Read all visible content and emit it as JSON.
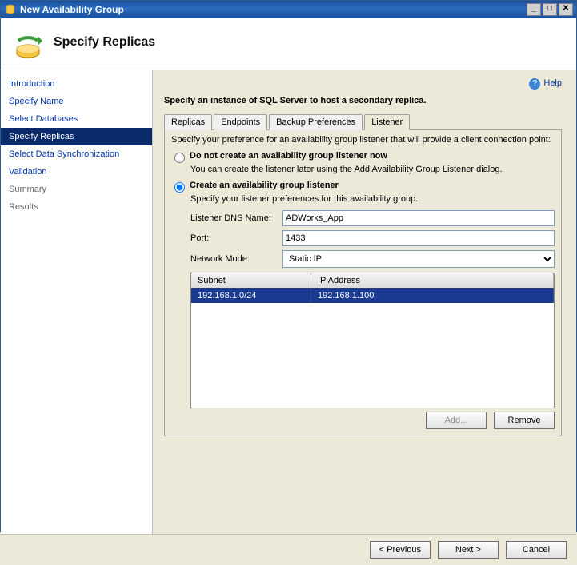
{
  "window": {
    "title": "New Availability Group"
  },
  "header": {
    "title": "Specify Replicas"
  },
  "help": {
    "label": "Help"
  },
  "sidebar": {
    "items": [
      {
        "label": "Introduction",
        "state": "link"
      },
      {
        "label": "Specify Name",
        "state": "link"
      },
      {
        "label": "Select Databases",
        "state": "link"
      },
      {
        "label": "Specify Replicas",
        "state": "active"
      },
      {
        "label": "Select Data Synchronization",
        "state": "link"
      },
      {
        "label": "Validation",
        "state": "link"
      },
      {
        "label": "Summary",
        "state": "pending"
      },
      {
        "label": "Results",
        "state": "pending"
      }
    ]
  },
  "content": {
    "instruction": "Specify an instance of SQL Server to host a secondary replica.",
    "tabs": [
      "Replicas",
      "Endpoints",
      "Backup Preferences",
      "Listener"
    ],
    "active_tab": 3,
    "listener": {
      "description": "Specify your preference for an availability group listener that will provide a client connection point:",
      "option_no_create": {
        "label": "Do not create an availability group listener now",
        "sub": "You can create the listener later using the Add Availability Group Listener dialog."
      },
      "option_create": {
        "label": "Create an availability group listener",
        "sub": "Specify your listener preferences for this availability group."
      },
      "selected": "create",
      "form": {
        "dns_label": "Listener DNS Name:",
        "dns_value": "ADWorks_App",
        "port_label": "Port:",
        "port_value": "1433",
        "mode_label": "Network Mode:",
        "mode_value": "Static IP"
      },
      "grid": {
        "headers": {
          "subnet": "Subnet",
          "ip": "IP Address"
        },
        "rows": [
          {
            "subnet": "192.168.1.0/24",
            "ip": "192.168.1.100"
          }
        ]
      },
      "buttons": {
        "add": "Add...",
        "remove": "Remove"
      }
    }
  },
  "footer": {
    "previous": "< Previous",
    "next": "Next >",
    "cancel": "Cancel"
  }
}
